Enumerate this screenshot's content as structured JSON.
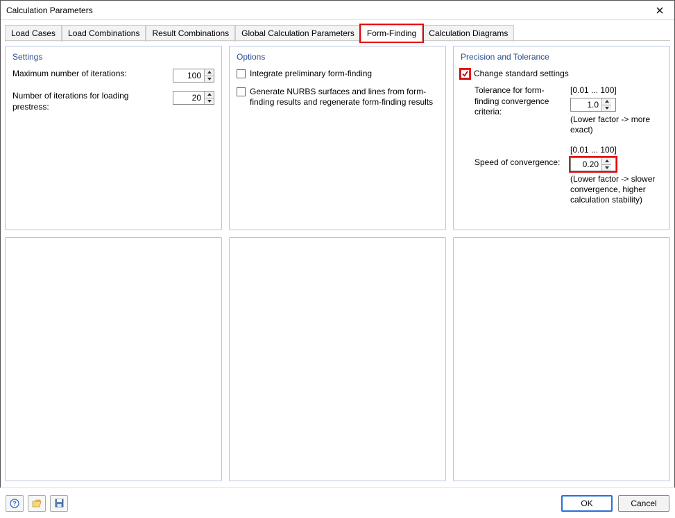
{
  "window": {
    "title": "Calculation Parameters"
  },
  "tabs": [
    {
      "label": "Load Cases"
    },
    {
      "label": "Load Combinations"
    },
    {
      "label": "Result Combinations"
    },
    {
      "label": "Global Calculation Parameters"
    },
    {
      "label": "Form-Finding"
    },
    {
      "label": "Calculation Diagrams"
    }
  ],
  "settings": {
    "title": "Settings",
    "max_iter_label": "Maximum number of iterations:",
    "max_iter_value": "100",
    "prestress_label": "Number of iterations for loading prestress:",
    "prestress_value": "20"
  },
  "options": {
    "title": "Options",
    "opt1": "Integrate preliminary form-finding",
    "opt2": "Generate NURBS surfaces and lines from form-finding results and regenerate form-finding results"
  },
  "precision": {
    "title": "Precision and Tolerance",
    "change_label": "Change standard settings",
    "tol_label": "Tolerance for form-finding convergence criteria:",
    "tol_range": "[0.01 ... 100]",
    "tol_value": "1.0",
    "tol_note": "(Lower factor -> more exact)",
    "speed_label": "Speed of convergence:",
    "speed_range": "[0.01 ... 100]",
    "speed_value": "0.20",
    "speed_note": "(Lower factor -> slower convergence, higher calculation stability)"
  },
  "footer": {
    "ok": "OK",
    "cancel": "Cancel"
  }
}
